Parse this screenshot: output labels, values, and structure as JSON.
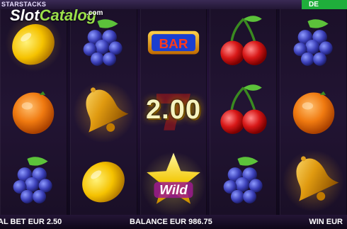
{
  "header": {
    "brand": "STARSTACKS",
    "mode_badge": "DE"
  },
  "watermark": {
    "part1": "Slot",
    "part2": "Catalog",
    "suffix": ".com"
  },
  "win_display": "2.00",
  "wild_label": "Wild",
  "bar_label": "BAR",
  "reels": [
    [
      "lemon",
      "orange",
      "grapes"
    ],
    [
      "grapes",
      "bell",
      "lemon"
    ],
    [
      "bar",
      "seven",
      "wild-star"
    ],
    [
      "cherries",
      "cherries",
      "grapes"
    ],
    [
      "grapes",
      "orange",
      "bell"
    ]
  ],
  "footer": {
    "total_bet": "AL BET EUR 2.50",
    "balance": "BALANCE EUR 986.75",
    "win": "WIN EUR"
  },
  "colors": {
    "demo_badge": "#1fae3b",
    "win_text": "#f6f3c0"
  }
}
